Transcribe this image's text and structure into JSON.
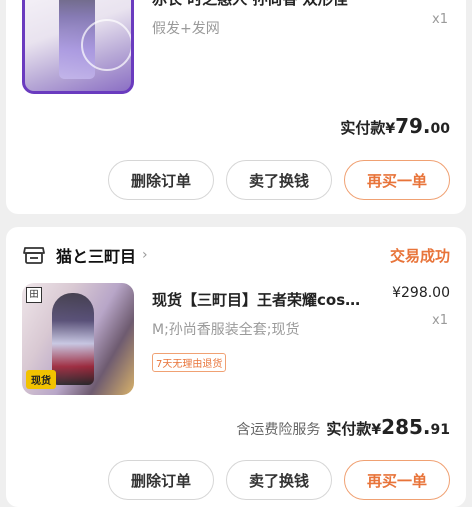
{
  "order1": {
    "title": "赤长 时之惑人 孙尚香 双形怪",
    "sku": "假发+发网",
    "qty": "x1",
    "paid_label": "实付款",
    "currency": "¥",
    "paid_int": "79.",
    "paid_dec": "00",
    "buttons": {
      "delete": "删除订单",
      "sell": "卖了换钱",
      "rebuy": "再买一单"
    }
  },
  "order2": {
    "shop_name": "猫と三町目",
    "status": "交易成功",
    "title": "现货【三町目】王者荣耀cos…",
    "price": "¥298.00",
    "sku": "M;孙尚香服装全套;现货",
    "qty": "x1",
    "tag": "7天无理由退货",
    "thumb_badge": "现货",
    "service": "含运费险服务",
    "paid_label": "实付款",
    "currency": "¥",
    "paid_int": "285.",
    "paid_dec": "91",
    "buttons": {
      "delete": "删除订单",
      "sell": "卖了换钱",
      "rebuy": "再买一单"
    }
  },
  "colors": {
    "accent": "#e8743a",
    "accent_border": "#f0a173",
    "muted": "#9a9a9a",
    "background": "#efefef"
  },
  "icons": {
    "shop": "store-icon",
    "chevron": "chevron-right-icon"
  }
}
